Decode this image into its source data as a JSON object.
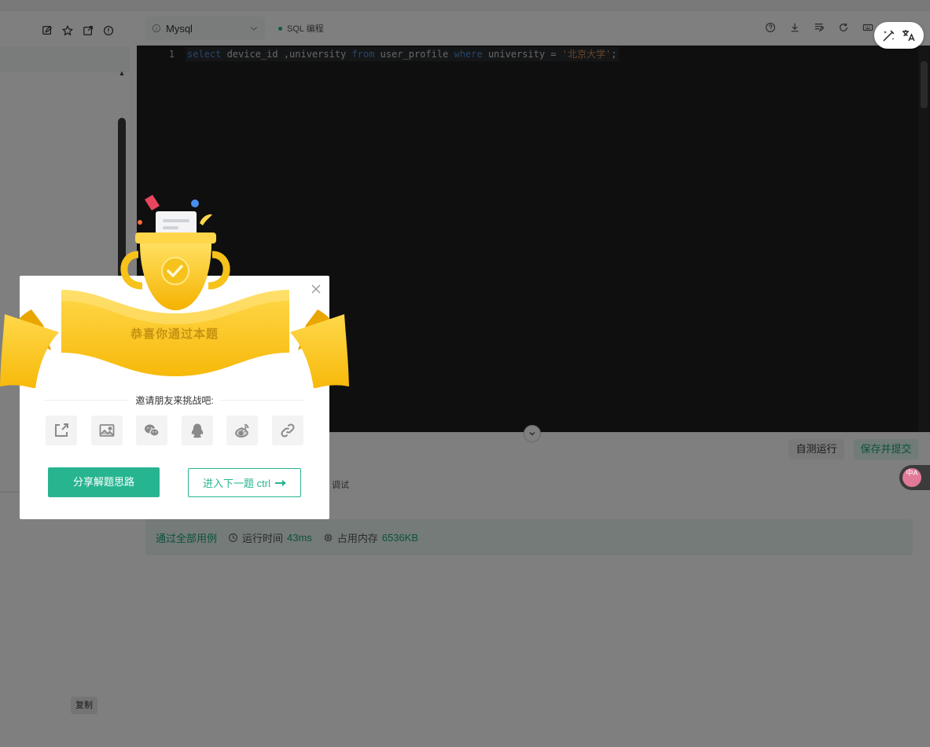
{
  "editor": {
    "language": "Mysql",
    "mode": "SQL 编程",
    "line_number": "1",
    "code_tokens": [
      {
        "t": "select",
        "c": "kw"
      },
      {
        "t": " device_id ,university ",
        "c": "id"
      },
      {
        "t": "from",
        "c": "kw"
      },
      {
        "t": " user_profile ",
        "c": "id"
      },
      {
        "t": "where",
        "c": "kw"
      },
      {
        "t": " university = ",
        "c": "id"
      },
      {
        "t": "'北京大学'",
        "c": "str"
      },
      {
        "t": ";",
        "c": "id"
      }
    ]
  },
  "actions": {
    "self_run": "自测运行",
    "submit": "保存并提交",
    "debug_tab": "调试"
  },
  "result": {
    "status": "通过全部用例",
    "runtime_label": "运行时间",
    "runtime_value": "43ms",
    "memory_label": "占用内存",
    "memory_value": "6536KB"
  },
  "left": {
    "copy": "复制"
  },
  "modal": {
    "title": "恭喜你通过本题",
    "invite": "邀请朋友来挑战吧:",
    "share_label": "分享解题思路",
    "next_label": "进入下一题 ctrl"
  },
  "colors": {
    "accent": "#27b590",
    "gold": "#f5b700",
    "editor_bg": "#1e1e1e"
  },
  "badge": {
    "text": "中A"
  }
}
